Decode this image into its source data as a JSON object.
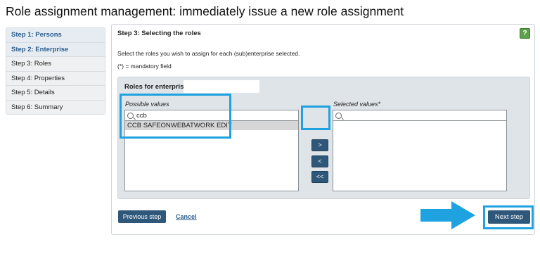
{
  "page": {
    "title": "Role assignment management: immediately issue a new role assignment"
  },
  "sidebar": {
    "steps": [
      {
        "label": "Step 1: Persons"
      },
      {
        "label": "Step 2: Enterprise"
      },
      {
        "label": "Step 3: Roles"
      },
      {
        "label": "Step 4: Properties"
      },
      {
        "label": "Step 5: Details"
      },
      {
        "label": "Step 6: Summary"
      }
    ]
  },
  "main": {
    "title": "Step 3: Selecting the roles",
    "help_icon": "?",
    "instruction": "Select the roles you wish to assign for each (sub)enterprise selected.",
    "mandatory_note": "(*) = mandatory field",
    "roles_label": "Roles for enterprise:",
    "enterprise_value": "",
    "possible": {
      "label": "Possible values",
      "search_value": "ccb",
      "items": [
        "CCB SAFEONWEBATWORK EDIT"
      ]
    },
    "selected": {
      "label": "Selected values*",
      "search_value": ""
    },
    "move_buttons": {
      "add": ">",
      "remove": "<",
      "remove_all": "<<"
    },
    "previous_label": "Previous step",
    "cancel_label": "Cancel",
    "next_label": "Next step"
  },
  "colors": {
    "accent": "#2f5779",
    "highlight": "#1ea3e0",
    "help": "#5da14a"
  }
}
